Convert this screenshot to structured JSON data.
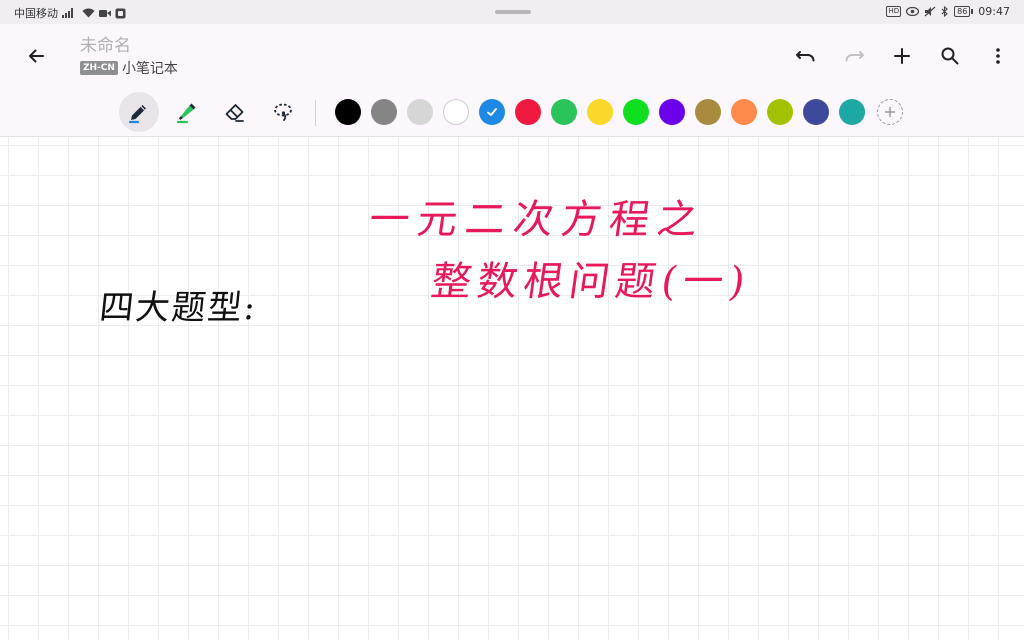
{
  "status_bar": {
    "carrier": "中国移动",
    "signal_label": "ⁿᴰ",
    "hd_badge": "HD",
    "battery": "86",
    "time": "09:47"
  },
  "app_bar": {
    "title": "未命名",
    "lang_badge": "ZH-CN",
    "notebook": "小笔记本"
  },
  "icons": {
    "back": "arrow-left-icon",
    "undo": "undo-icon",
    "redo": "redo-icon",
    "add": "plus-icon",
    "search": "search-icon",
    "more": "more-vertical-icon"
  },
  "tools": [
    {
      "name": "pen",
      "active": true
    },
    {
      "name": "highlighter",
      "active": false
    },
    {
      "name": "eraser",
      "active": false
    },
    {
      "name": "lasso",
      "active": false
    }
  ],
  "colors": [
    "#000000",
    "#858585",
    "#d6d6d6",
    "#ffffff",
    "#1e88e5",
    "#f0193f",
    "#2bc45a",
    "#fbd72b",
    "#10de20",
    "#6d00ea",
    "#a88b3e",
    "#ff8a4c",
    "#a3c300",
    "#3d4a9c",
    "#1da7a5"
  ],
  "selected_color_index": 4,
  "handwriting": {
    "heading_line_1": "一元二次方程之",
    "heading_line_2": "整数根问题(一)",
    "note": "四大题型:"
  }
}
